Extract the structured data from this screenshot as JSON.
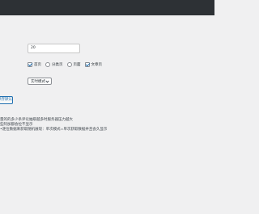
{
  "form": {
    "count_value": "20",
    "checkboxes": [
      {
        "label": "首页",
        "checked": true
      },
      {
        "label": "分类页",
        "checked": false
      },
      {
        "label": "页面",
        "checked": false
      },
      {
        "label": "文章页",
        "checked": true
      }
    ],
    "mode_select": "实时模式",
    "save_label": "保存默认"
  },
  "notes": [
    "量的的多少条评论抽取越多时服务器压力越大",
    "些阿加都会拉不显示",
    "•逐位数据来获取随机展现：单次模式=单次获取数据并且会久显示"
  ],
  "colors": {
    "topbar": "#2d3135",
    "background": "#f0f0f1",
    "accent": "#2271b1"
  }
}
